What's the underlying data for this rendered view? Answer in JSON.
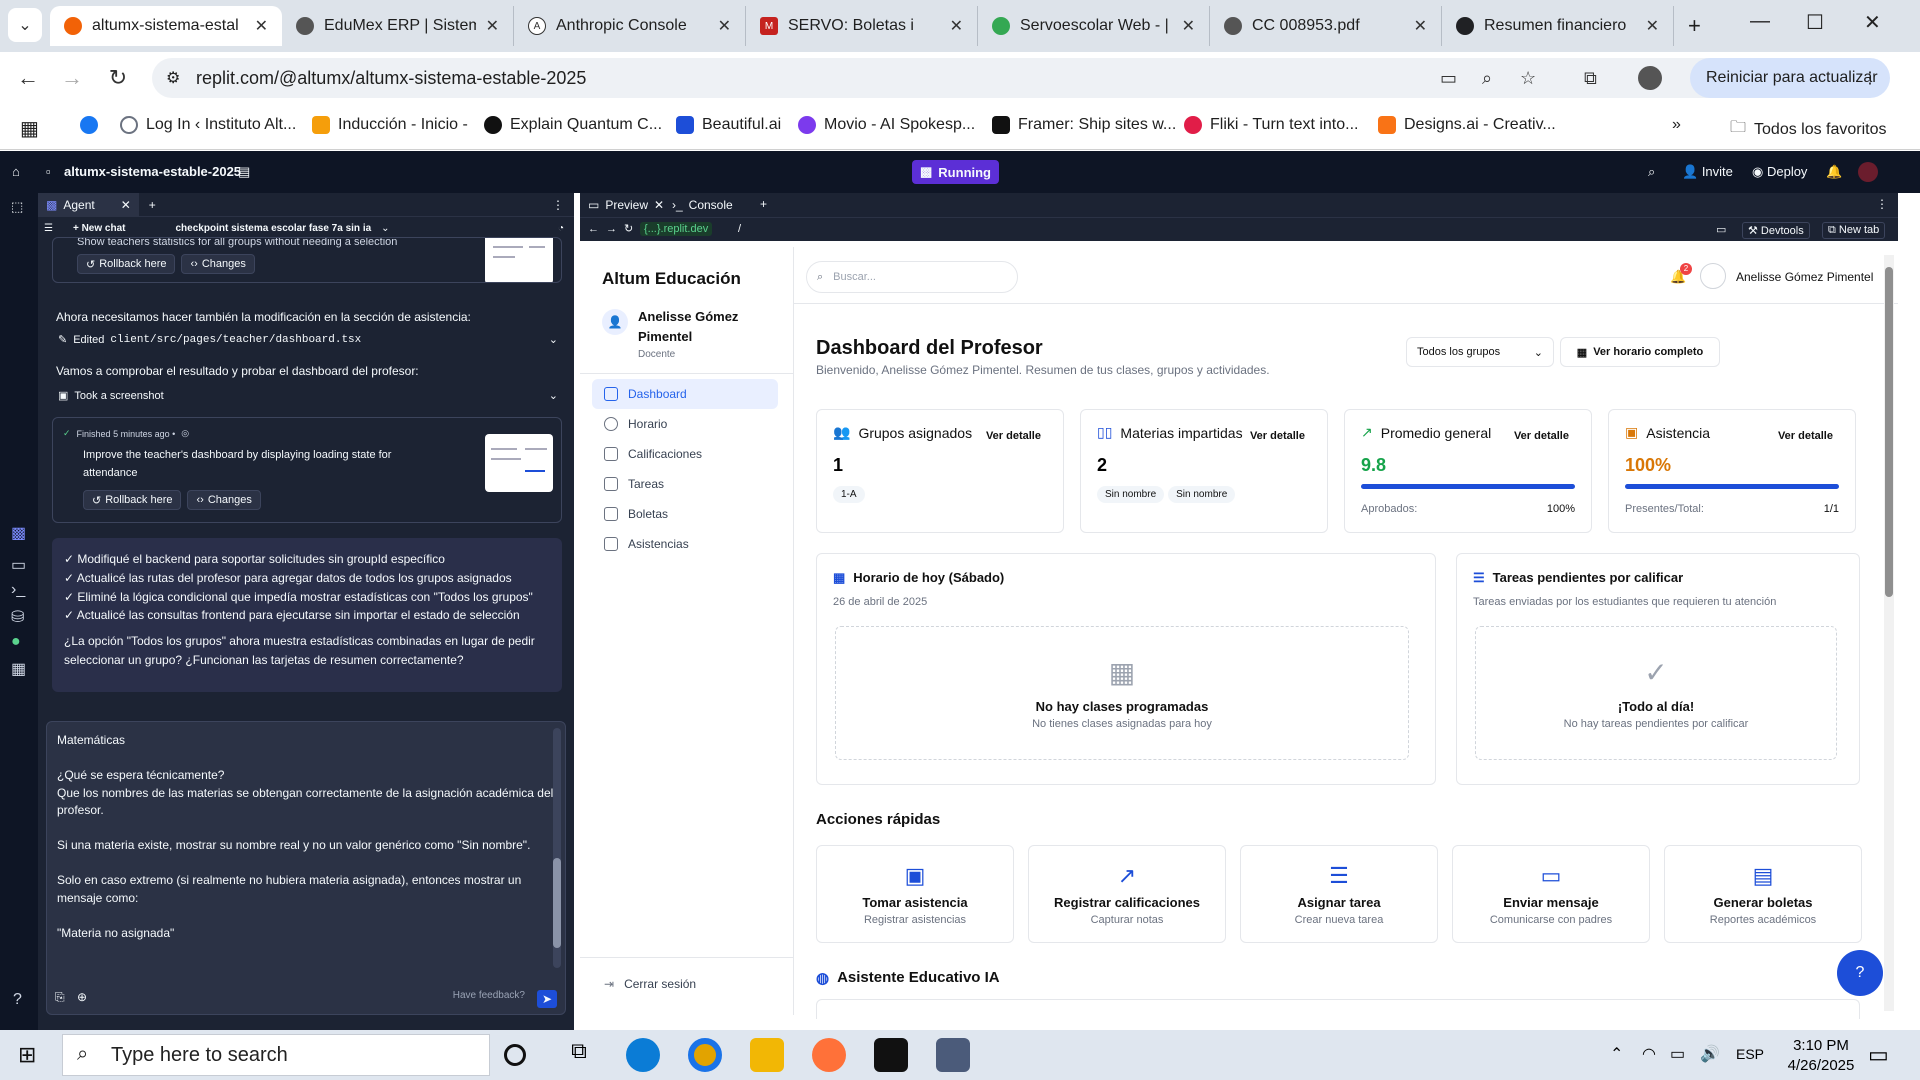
{
  "browser": {
    "tabs": [
      {
        "title": "altumx-sistema-estal",
        "color": "#f26207"
      },
      {
        "title": "EduMex ERP | Sistem",
        "color": "#5f6368"
      },
      {
        "title": "Anthropic Console",
        "color": "#3b3b3b"
      },
      {
        "title": "SERVO: Boletas i",
        "color": "#c5221f"
      },
      {
        "title": "Servoescolar Web - |",
        "color": "#34a853"
      },
      {
        "title": "CC 008953.pdf",
        "color": "#5f6368"
      },
      {
        "title": "Resumen financiero",
        "color": "#202124"
      }
    ],
    "url": "replit.com/@altumx/altumx-sistema-estable-2025",
    "update_label": "Reiniciar para actualizar",
    "bookmarks": [
      "Log In ‹ Instituto Alt...",
      "Inducción - Inicio -",
      "Explain Quantum C...",
      "Beautiful.ai",
      "Movio - AI Spokesp...",
      "Framer: Ship sites w...",
      "Fliki - Turn text into...",
      "Designs.ai - Creativ..."
    ],
    "all_favorites": "Todos los favoritos"
  },
  "replit": {
    "repl_name": "altumx-sistema-estable-2025",
    "status": "Running",
    "invite": "Invite",
    "deploy": "Deploy",
    "agent_tab": "Agent",
    "new_chat": "+ New chat",
    "checkpoint": "checkpoint sistema escolar fase 7a sin ia",
    "cut_text": "Show teachers statistics for all groups without needing a selection",
    "rollback": "Rollback here",
    "changes": "Changes",
    "msg1": "Ahora necesitamos hacer también la modificación en la sección de asistencia:",
    "edited_prefix": "Edited",
    "edited_file": "client/src/pages/teacher/dashboard.tsx",
    "msg2": "Vamos a comprobar el resultado y probar el dashboard del profesor:",
    "screenshot": "Took a screenshot",
    "finished": "Finished 5 minutes ago •",
    "improve": "Improve the teacher's dashboard by displaying loading state for attendance",
    "summary_lines": [
      "✓ Modifiqué el backend para soportar solicitudes sin groupId específico",
      "✓ Actualicé las rutas del profesor para agregar datos de todos los grupos asignados",
      "✓ Eliminé la lógica condicional que impedía mostrar estadísticas con \"Todos los grupos\"",
      "✓ Actualicé las consultas frontend para ejecutarse sin importar el estado de selección"
    ],
    "summary_question": "¿La opción \"Todos los grupos\" ahora muestra estadísticas combinadas en lugar de pedir seleccionar un grupo? ¿Funcionan las tarjetas de resumen correctamente?",
    "input_lines": [
      "Matemáticas",
      "",
      "¿Qué se espera técnicamente?",
      "Que los nombres de las materias se obtengan correctamente de la asignación académica del profesor.",
      "",
      "Si una materia existe, mostrar su nombre real y no un valor genérico como \"Sin nombre\".",
      "",
      "Solo en caso extremo (si realmente no hubiera materia asignada), entonces mostrar un mensaje como:",
      "",
      "\"Materia no asignada\""
    ],
    "feedback": "Have feedback?",
    "preview_tab": "Preview",
    "console_tab": "Console",
    "preview_url": "{...}.replit.dev",
    "preview_path": "/",
    "devtools": "Devtools",
    "new_tab": "New tab"
  },
  "app": {
    "brand": "Altum Educación",
    "user_name": "Anelisse Gómez Pimentel",
    "user_role": "Docente",
    "nav": [
      "Dashboard",
      "Horario",
      "Calificaciones",
      "Tareas",
      "Boletas",
      "Asistencias"
    ],
    "logout": "Cerrar sesión",
    "search_placeholder": "Buscar...",
    "notif_count": "2",
    "title": "Dashboard del Profesor",
    "subtitle": "Bienvenido, Anelisse Gómez Pimentel. Resumen de tus clases, grupos y actividades.",
    "group_select": "Todos los grupos",
    "schedule_btn": "Ver horario completo",
    "detail": "Ver detalle",
    "stats": [
      {
        "title": "Grupos asignados",
        "value": "1",
        "chips": [
          "1-A"
        ]
      },
      {
        "title": "Materias impartidas",
        "value": "2",
        "chips": [
          "Sin nombre",
          "Sin nombre"
        ]
      },
      {
        "title": "Promedio general",
        "value": "9.8",
        "label": "Aprobados:",
        "right": "100%",
        "progress": 1.0
      },
      {
        "title": "Asistencia",
        "value": "100%",
        "label": "Presentes/Total:",
        "right": "1/1",
        "progress": 1.0
      }
    ],
    "today_title": "Horario de hoy (Sábado)",
    "today_date": "26 de abril de 2025",
    "today_empty": "No hay clases programadas",
    "today_empty_sub": "No tienes clases asignadas para hoy",
    "tasks_title": "Tareas pendientes por calificar",
    "tasks_sub": "Tareas enviadas por los estudiantes que requieren tu atención",
    "tasks_empty": "¡Todo al día!",
    "tasks_empty_sub": "No hay tareas pendientes por calificar",
    "quick_title": "Acciones rápidas",
    "quick": [
      {
        "t": "Tomar asistencia",
        "s": "Registrar asistencias"
      },
      {
        "t": "Registrar calificaciones",
        "s": "Capturar notas"
      },
      {
        "t": "Asignar tarea",
        "s": "Crear nueva tarea"
      },
      {
        "t": "Enviar mensaje",
        "s": "Comunicarse con padres"
      },
      {
        "t": "Generar boletas",
        "s": "Reportes académicos"
      }
    ],
    "assistant": "Asistente Educativo IA"
  },
  "taskbar": {
    "search_placeholder": "Type here to search",
    "lang": "ESP",
    "time": "3:10 PM",
    "date": "4/26/2025"
  }
}
